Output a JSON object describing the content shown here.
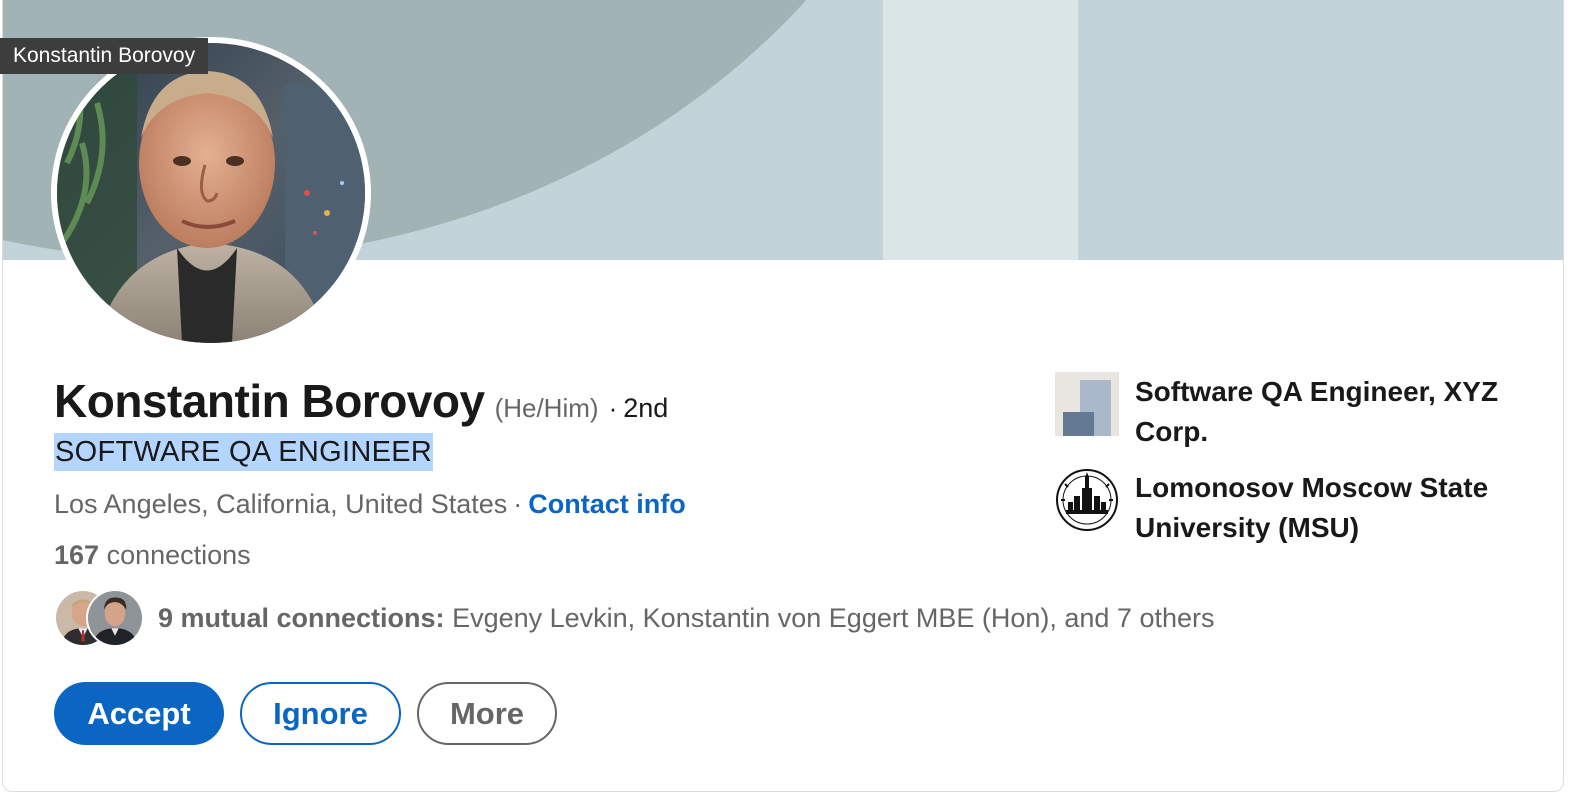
{
  "tooltip": {
    "text": "Konstantin Borovoy"
  },
  "profile": {
    "name": "Konstantin Borovoy",
    "pronouns": "(He/Him)",
    "separator": "·",
    "degree": "2nd",
    "headline": "SOFTWARE QA ENGINEER",
    "location": "Los Angeles, California, United States",
    "location_separator": "·",
    "contact_info_label": "Contact info",
    "connections_count": "167",
    "connections_label": "connections"
  },
  "mutual": {
    "label": "9 mutual connections:",
    "names": "Evgeny Levkin, Konstantin von Eggert MBE (Hon), and 7 others"
  },
  "actions": {
    "accept": "Accept",
    "ignore": "Ignore",
    "more": "More"
  },
  "highlights": [
    {
      "label": "Software QA Engineer, XYZ Corp.",
      "icon": "company-logo-icon"
    },
    {
      "label": "Lomonosov Moscow State University (MSU)",
      "icon": "university-seal-icon"
    }
  ],
  "colors": {
    "accent": "#0a66c2",
    "banner_dark": "#a2b3b6",
    "banner_light": "#c2d4d9",
    "headline_highlight": "#b4d5fe"
  }
}
